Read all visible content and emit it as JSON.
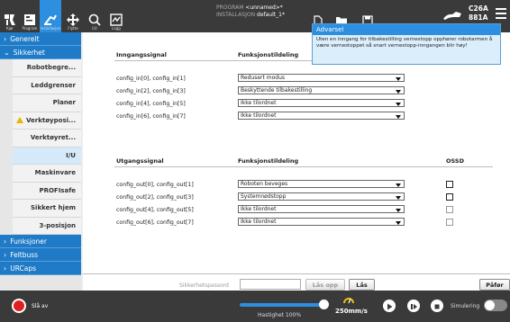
{
  "toolbar": {
    "run_label": "Kjør",
    "program_label": "Program",
    "installation_label": "Installasjon",
    "move_label": "Flytte",
    "io_label": "I/U",
    "log_label": "Logg",
    "new_label": "Ny...",
    "open_label": "Åpne...",
    "save_label": "Lagre",
    "program_key": "PROGRAM",
    "program_value": "<unnamed>*",
    "installation_key": "INSTALLASJON",
    "installation_value": "default_1*",
    "robot_id_line1": "C26A",
    "robot_id_line2": "881A"
  },
  "sidebar": {
    "generelt": "Generelt",
    "sikkerhet": "Sikkerhet",
    "items": [
      {
        "label": "Robotbegre..."
      },
      {
        "label": "Leddgrenser"
      },
      {
        "label": "Planer"
      },
      {
        "label": "Verktøyposi..."
      },
      {
        "label": "Verktøyret..."
      },
      {
        "label": "I/U"
      },
      {
        "label": "Maskinvare"
      },
      {
        "label": "PROFIsafe"
      },
      {
        "label": "Sikkert hjem"
      },
      {
        "label": "3-posisjon"
      }
    ],
    "funksjoner": "Funksjoner",
    "feltbuss": "Feltbuss",
    "urcaps": "URCaps"
  },
  "inputs": {
    "col_signal": "Inngangssignal",
    "col_function": "Funksjonstildeling",
    "rows": [
      {
        "signal": "config_in[0], config_in[1]",
        "function": "Redusert modus"
      },
      {
        "signal": "config_in[2], config_in[3]",
        "function": "Beskyttende tilbakestilling"
      },
      {
        "signal": "config_in[4], config_in[5]",
        "function": "Ikke tilordnet"
      },
      {
        "signal": "config_in[6], config_in[7]",
        "function": "Ikke tilordnet"
      }
    ]
  },
  "outputs": {
    "col_signal": "Utgangssignal",
    "col_function": "Funksjonstildeling",
    "col_ossd": "OSSD",
    "rows": [
      {
        "signal": "config_out[0], config_out[1]",
        "function": "Roboten beveges"
      },
      {
        "signal": "config_out[2], config_out[3]",
        "function": "Systemnødstopp"
      },
      {
        "signal": "config_out[4], config_out[5]",
        "function": "Ikke tilordnet"
      },
      {
        "signal": "config_out[6], config_out[7]",
        "function": "Ikke tilordnet"
      }
    ]
  },
  "tooltip": {
    "title": "Advarsel",
    "body": "Uten en inngang for tilbakestilling vernestopp opphører robotarmen å være vernestoppet så snart vernestopp-inngangen blir høy!"
  },
  "footer": {
    "password_label": "Sikkerhetspassord",
    "unlock_label": "Lås opp",
    "lock_label": "Lås",
    "apply_label": "Påfør"
  },
  "bottom": {
    "power_label": "Slå av",
    "speed_label": "Hastighet 100%",
    "speed_value": "250mm/s",
    "sim_label": "Simulering"
  },
  "colors": {
    "accent": "#2d8fe0",
    "topbar": "#3a3a3a",
    "warning": "#e8b400",
    "power": "#e02020"
  }
}
